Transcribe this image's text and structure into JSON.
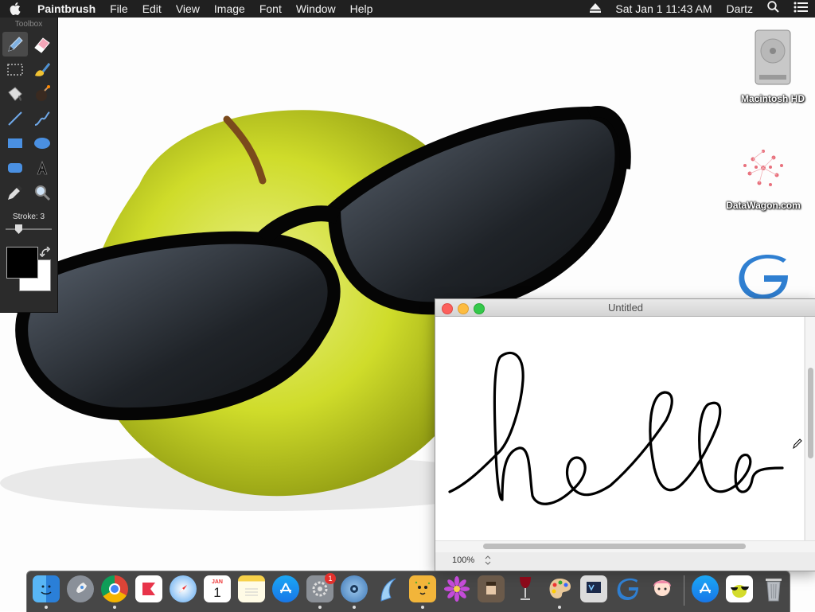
{
  "menubar": {
    "app_name": "Paintbrush",
    "menus": [
      "File",
      "Edit",
      "View",
      "Image",
      "Font",
      "Window",
      "Help"
    ],
    "clock": "Sat Jan 1  11:43 AM",
    "user": "Dartz"
  },
  "toolbox": {
    "title": "Toolbox",
    "stroke_label": "Stroke: 3",
    "foreground_color": "#000000",
    "background_color": "#ffffff"
  },
  "desktop_icons": [
    {
      "label": "Macintosh HD"
    },
    {
      "label": "DataWagon.com"
    }
  ],
  "window": {
    "title": "Untitled",
    "zoom": "100%",
    "drawing_text": "hello"
  },
  "dock": {
    "calendar_month": "JAN",
    "calendar_day": "1",
    "prefs_badge": "1"
  }
}
